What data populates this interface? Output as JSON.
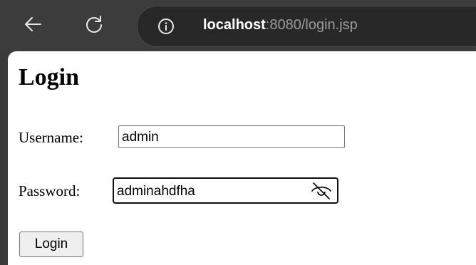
{
  "browser": {
    "url_host": "localhost",
    "url_rest": ":8080/login.jsp",
    "icons": {
      "back": "arrow-left-icon",
      "reload": "reload-icon",
      "info": "info-icon"
    }
  },
  "page": {
    "title": "Login",
    "username_label": "Username:",
    "username_value": "admin",
    "password_label": "Password:",
    "password_value": "adminahdfha",
    "password_toggle_icon": "eye-slash-icon",
    "login_button": "Login"
  }
}
